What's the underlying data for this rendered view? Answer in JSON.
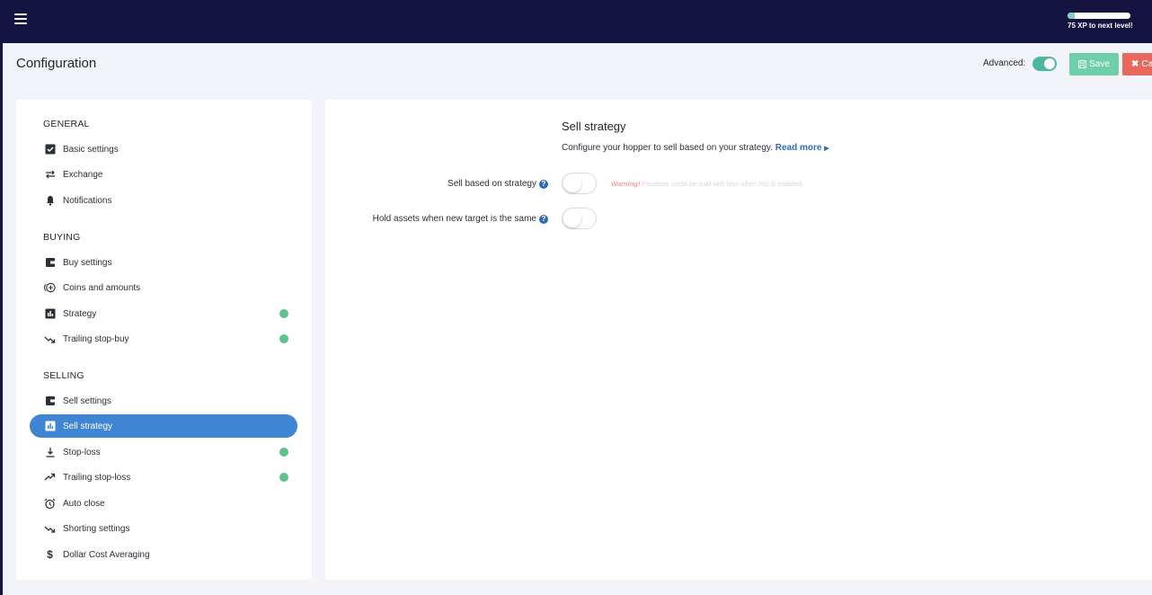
{
  "topbar": {
    "menu_icon": "hamburger-icon",
    "xp_progress": 0.12,
    "xp_text": "75 XP to next level!"
  },
  "header": {
    "title": "Configuration",
    "advanced_label": "Advanced:",
    "advanced_on": true,
    "save_label": "Save",
    "cancel_label": "Ca"
  },
  "sidebar": {
    "sections": [
      {
        "title": "GENERAL",
        "items": [
          {
            "label": "Basic settings",
            "icon": "checkbox-icon",
            "dot": false
          },
          {
            "label": "Exchange",
            "icon": "swap-arrows-icon",
            "dot": false
          },
          {
            "label": "Notifications",
            "icon": "bell-icon",
            "dot": false
          }
        ]
      },
      {
        "title": "BUYING",
        "items": [
          {
            "label": "Buy settings",
            "icon": "wallet-icon",
            "dot": false
          },
          {
            "label": "Coins and amounts",
            "icon": "coins-plus-icon",
            "dot": false
          },
          {
            "label": "Strategy",
            "icon": "bar-chart-icon",
            "dot": true
          },
          {
            "label": "Trailing stop-buy",
            "icon": "trending-down-icon",
            "dot": true
          }
        ]
      },
      {
        "title": "SELLING",
        "items": [
          {
            "label": "Sell settings",
            "icon": "wallet-icon",
            "dot": false
          },
          {
            "label": "Sell strategy",
            "icon": "bar-chart-icon",
            "dot": false,
            "active": true
          },
          {
            "label": "Stop-loss",
            "icon": "download-icon",
            "dot": true
          },
          {
            "label": "Trailing stop-loss",
            "icon": "trending-up-icon",
            "dot": true
          },
          {
            "label": "Auto close",
            "icon": "alarm-clock-icon",
            "dot": false
          },
          {
            "label": "Shorting settings",
            "icon": "trending-down-icon",
            "dot": false
          },
          {
            "label": "Dollar Cost Averaging",
            "icon": "dollar-icon",
            "dot": false
          }
        ]
      }
    ]
  },
  "main": {
    "title": "Sell strategy",
    "description": "Configure your hopper to sell based on your strategy.",
    "read_more": "Read more",
    "settings": [
      {
        "label": "Sell based on strategy",
        "enabled": false
      },
      {
        "label": "Hold assets when new target is the same",
        "enabled": false
      }
    ],
    "warning_prefix": "Warning!",
    "warning_text": "Positions could be sold with loss when this is enabled."
  },
  "colors": {
    "topbar": "#15133f",
    "active_nav": "#3e85d3",
    "status_dot": "#5fc28e",
    "save": "#6fcfaa",
    "cancel": "#e8685e",
    "link": "#2f6ab5"
  }
}
